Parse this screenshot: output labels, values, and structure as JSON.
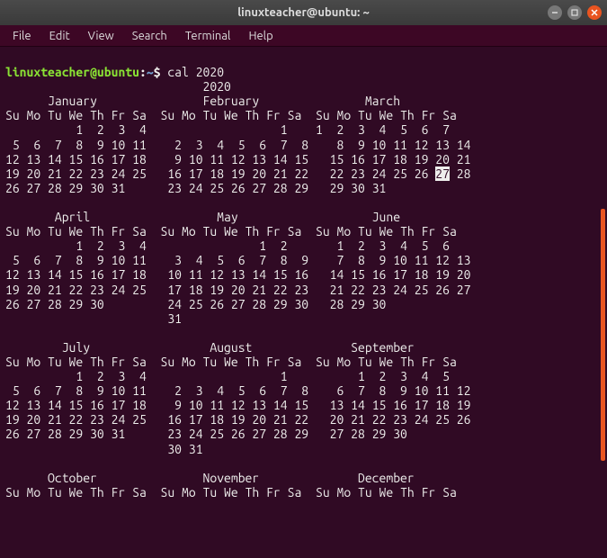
{
  "titlebar": {
    "title": "linuxteacher@ubuntu: ~"
  },
  "menu": {
    "file": "File",
    "edit": "Edit",
    "view": "View",
    "search": "Search",
    "terminal": "Terminal",
    "help": "Help"
  },
  "prompt": {
    "user_host": "linuxteacher@ubuntu",
    "sep": ":",
    "path": "~",
    "dollar": "$ ",
    "command": "cal 2020"
  },
  "cal": {
    "year_line": "                            2020",
    "header": "Su Mo Tu We Th Fr Sa",
    "pad": "  ",
    "today": "27",
    "months": [
      "January",
      "February",
      "March",
      "April",
      "May",
      "June",
      "July",
      "August",
      "September",
      "October",
      "November",
      "December"
    ],
    "rows": [
      {
        "titles": "      January               February               March          ",
        "weeks": [
          [
            "          1  2  3  4",
            "                   1",
            "    1  2  3  4  5  6  7"
          ],
          [
            " 5  6  7  8  9 10 11",
            "    2  3  4  5  6  7  8",
            "    8  9 10 11 12 13 14"
          ],
          [
            "12 13 14 15 16 17 18",
            "    9 10 11 12 13 14 15",
            "   15 16 17 18 19 20 21"
          ],
          [
            "19 20 21 22 23 24 25",
            "   16 17 18 19 20 21 22",
            "   22 23 24 25 26 "
          ],
          [
            "26 27 28 29 30 31   ",
            "   23 24 25 26 27 28 29",
            "   29 30 31            "
          ]
        ],
        "after_today": " 28"
      },
      {
        "titles": "       April                  May                   June          ",
        "weeks": [
          [
            "          1  2  3  4",
            "                1  2",
            "       1  2  3  4  5  6"
          ],
          [
            " 5  6  7  8  9 10 11",
            "    3  4  5  6  7  8  9",
            "    7  8  9 10 11 12 13"
          ],
          [
            "12 13 14 15 16 17 18",
            "   10 11 12 13 14 15 16",
            "   14 15 16 17 18 19 20"
          ],
          [
            "19 20 21 22 23 24 25",
            "   17 18 19 20 21 22 23",
            "   21 22 23 24 25 26 27"
          ],
          [
            "26 27 28 29 30      ",
            "   24 25 26 27 28 29 30",
            "   28 29 30            "
          ],
          [
            "                    ",
            "   31                  ",
            "                       "
          ]
        ]
      },
      {
        "titles": "        July                 August              September        ",
        "weeks": [
          [
            "          1  2  3  4",
            "                   1",
            "          1  2  3  4  5"
          ],
          [
            " 5  6  7  8  9 10 11",
            "    2  3  4  5  6  7  8",
            "    6  7  8  9 10 11 12"
          ],
          [
            "12 13 14 15 16 17 18",
            "    9 10 11 12 13 14 15",
            "   13 14 15 16 17 18 19"
          ],
          [
            "19 20 21 22 23 24 25",
            "   16 17 18 19 20 21 22",
            "   20 21 22 23 24 25 26"
          ],
          [
            "26 27 28 29 30 31   ",
            "   23 24 25 26 27 28 29",
            "   27 28 29 30         "
          ],
          [
            "                    ",
            "   30 31               ",
            "                       "
          ]
        ]
      },
      {
        "titles": "      October               November              December        ",
        "weeks_visible_header_only": true
      }
    ]
  }
}
